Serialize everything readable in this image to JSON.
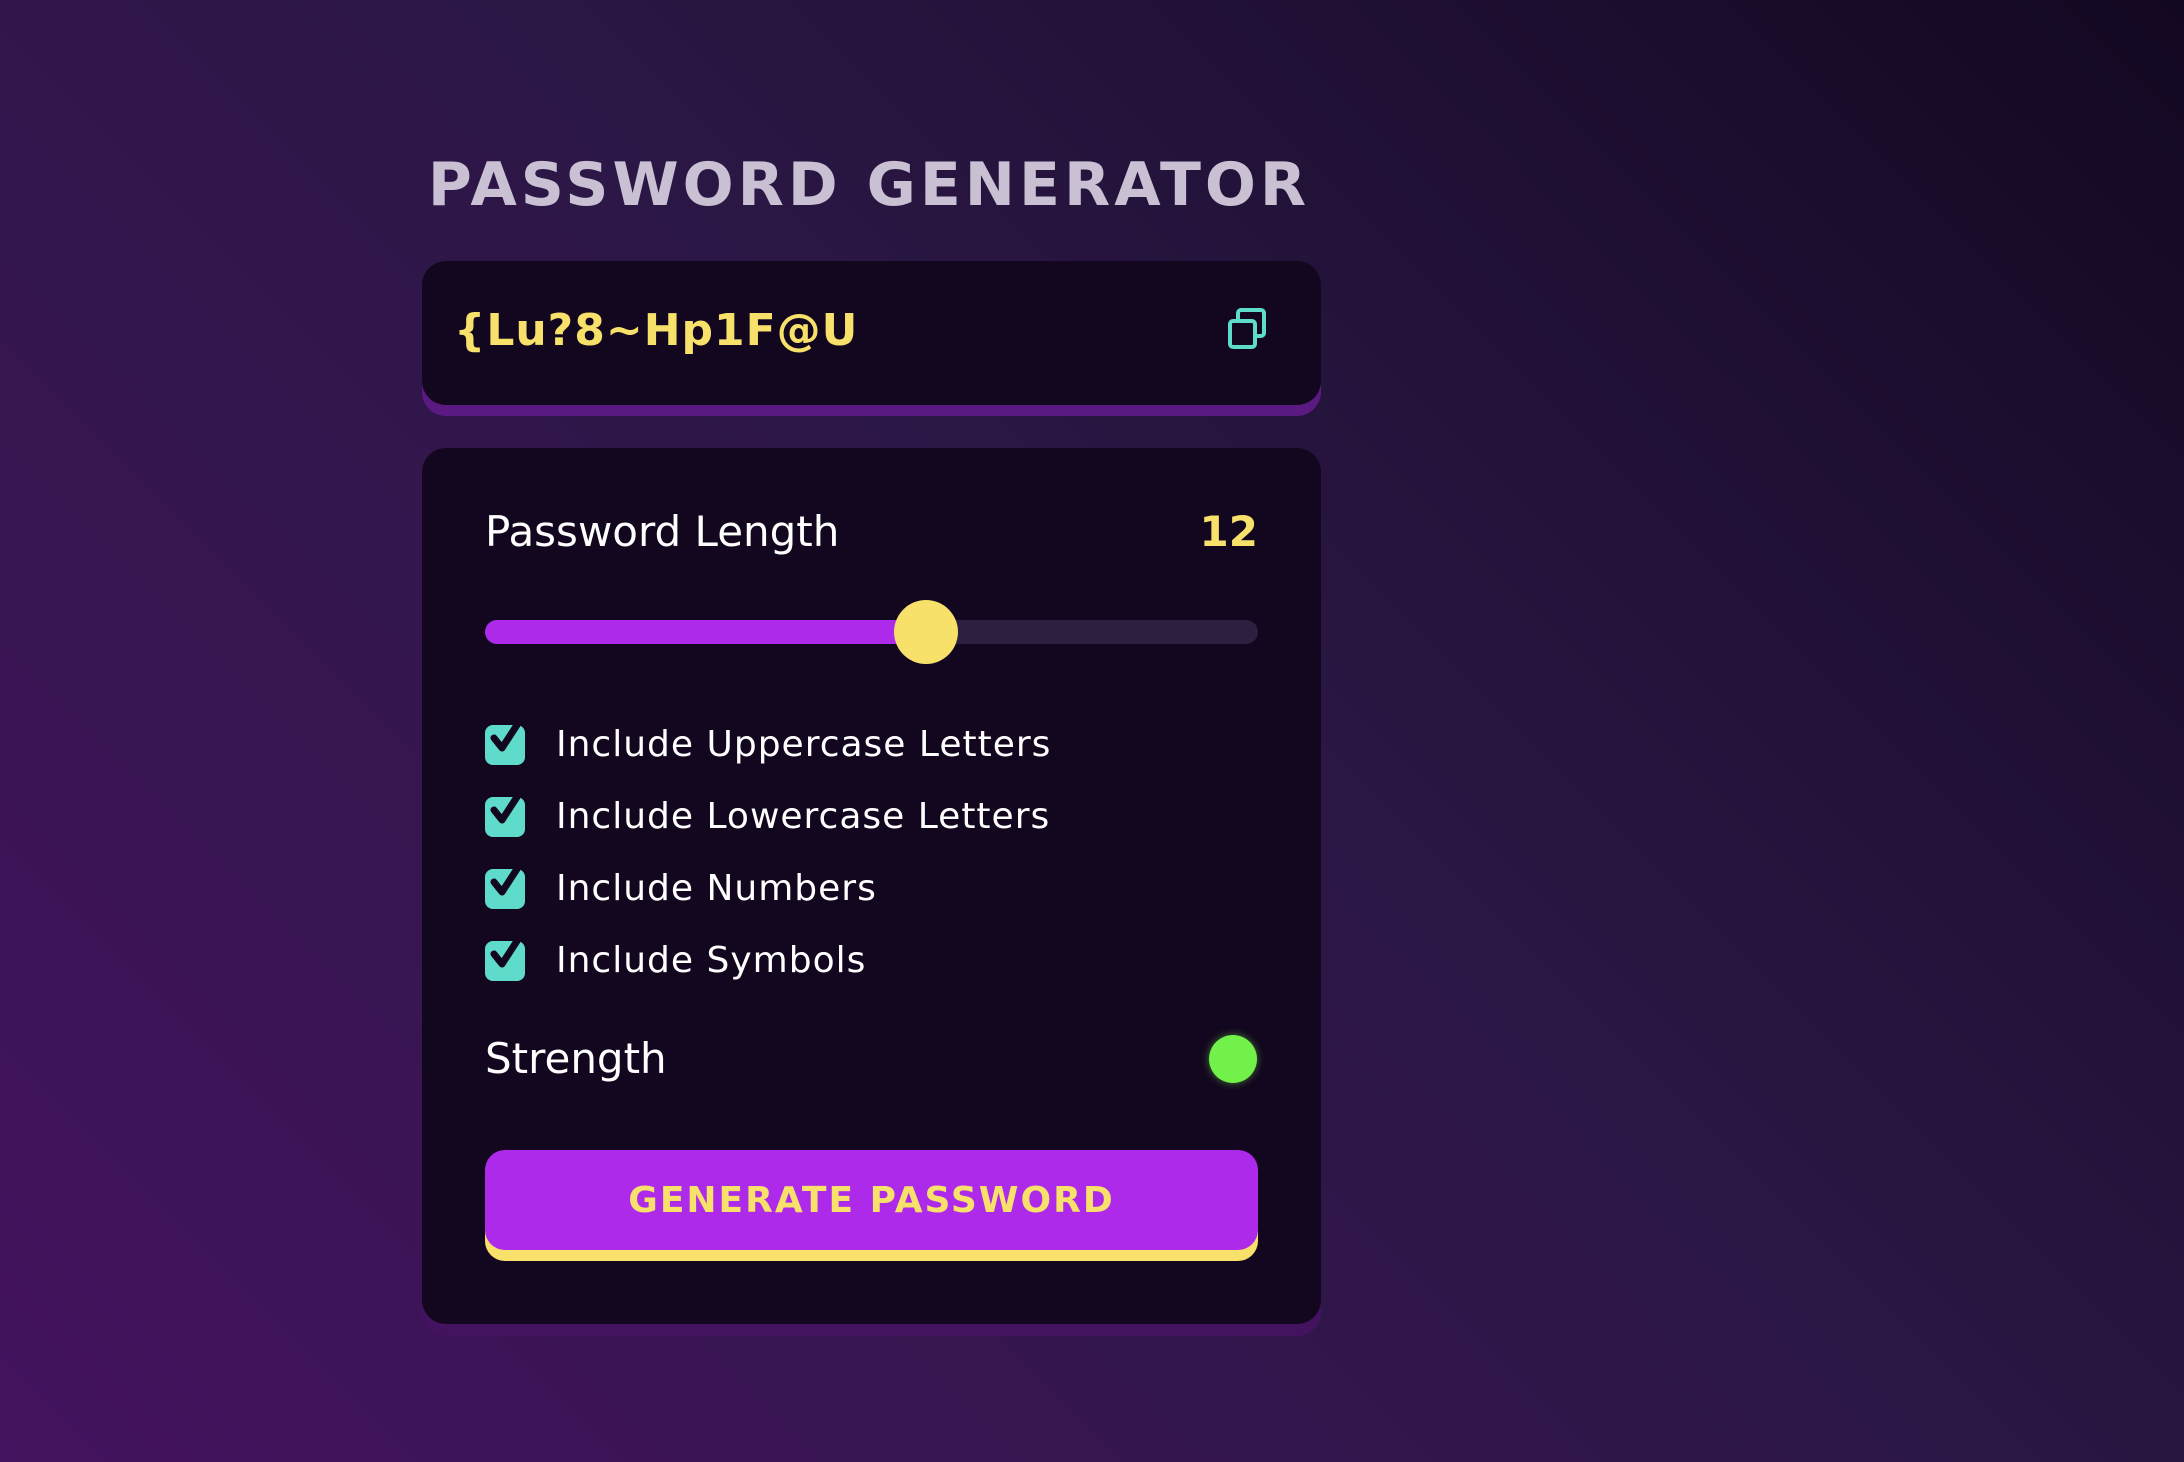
{
  "app": {
    "title": "PASSWORD GENERATOR"
  },
  "output": {
    "password": "{Lu?8~Hp1F@U",
    "copy_icon": "copy-icon"
  },
  "length": {
    "label": "Password Length",
    "value": "12",
    "slider_fraction": 0.57
  },
  "options": [
    {
      "label": "Include Uppercase Letters",
      "checked": true
    },
    {
      "label": "Include Lowercase Letters",
      "checked": true
    },
    {
      "label": "Include Numbers",
      "checked": true
    },
    {
      "label": "Include Symbols",
      "checked": true
    }
  ],
  "strength": {
    "label": "Strength",
    "indicator_color": "#71f14a"
  },
  "generate": {
    "label": "GENERATE PASSWORD"
  },
  "colors": {
    "accent_yellow": "#f7e16a",
    "accent_purple": "#ad2aeb",
    "checkbox_teal": "#5edbcb",
    "card_bg": "#13071f"
  }
}
